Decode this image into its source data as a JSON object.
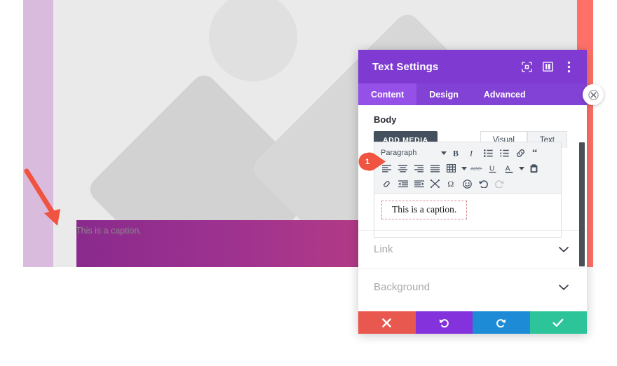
{
  "preview": {
    "caption_text": "This is a caption.",
    "placeholder_icon": "image-placeholder-icon",
    "gradient_from": "#8a2a8d",
    "gradient_to": "#c74f77",
    "lavender": "#d9bbdd",
    "outer_accent": "#ff7168"
  },
  "annotation": {
    "arrow_color": "#f0533f",
    "marker_number": "1",
    "marker_color": "#f0533f"
  },
  "modal": {
    "title": "Text Settings",
    "header_color": "#7e3ad1",
    "header_icons": [
      {
        "name": "fullscreen-icon"
      },
      {
        "name": "split-view-icon"
      },
      {
        "name": "more-options-icon"
      }
    ],
    "tabs": [
      {
        "label": "Content",
        "active": true
      },
      {
        "label": "Design",
        "active": false
      },
      {
        "label": "Advanced",
        "active": false
      }
    ],
    "body": {
      "section_label": "Body",
      "add_media_label": "ADD MEDIA",
      "editor_tabs": [
        {
          "label": "Visual",
          "active": true
        },
        {
          "label": "Text",
          "active": false
        }
      ],
      "toolbar": {
        "format_select": "Paragraph",
        "row1": [
          "bold-icon",
          "italic-icon",
          "bulleted-list-icon",
          "numbered-list-icon",
          "link-icon",
          "blockquote-icon"
        ],
        "row2": [
          "align-left-icon",
          "align-center-icon",
          "align-right-icon",
          "align-justify-icon",
          "table-icon",
          "strikethrough-icon",
          "underline-icon",
          "text-color-icon",
          "paste-icon"
        ],
        "row3": [
          "clear-formatting-icon",
          "decrease-indent-icon",
          "increase-indent-icon",
          "special-characters-icon",
          "omega-icon",
          "emoji-icon",
          "undo-icon",
          "redo-icon"
        ]
      },
      "editor_content": "This is a caption."
    },
    "accordions": [
      {
        "label": "Link",
        "chevron": "chevron-down-icon"
      },
      {
        "label": "Background",
        "chevron": "chevron-down-icon"
      }
    ],
    "footer_buttons": [
      {
        "name": "cancel-button",
        "icon": "close-icon",
        "color": "#e8584f"
      },
      {
        "name": "undo-button",
        "icon": "undo-icon",
        "color": "#8432db"
      },
      {
        "name": "redo-button",
        "icon": "redo-icon",
        "color": "#1e8bd6"
      },
      {
        "name": "save-button",
        "icon": "checkmark-icon",
        "color": "#2ec49a"
      }
    ]
  },
  "float_close": {
    "name": "close-settings-icon"
  }
}
